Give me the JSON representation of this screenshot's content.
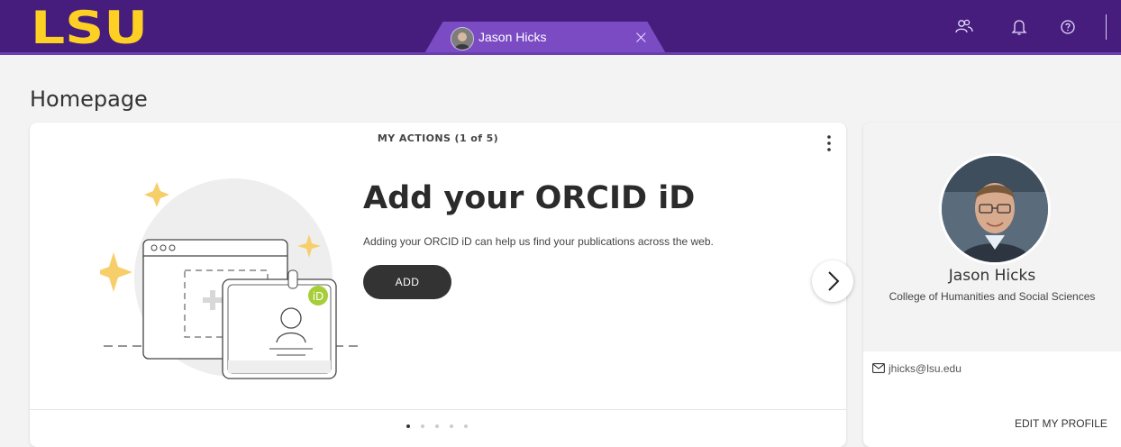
{
  "header": {
    "logo_text": "LSU",
    "user_tab": {
      "name": "Jason Hicks",
      "close_symbol": "×"
    },
    "icons": [
      "people-icon",
      "bell-icon",
      "help-icon"
    ]
  },
  "page": {
    "title": "Homepage"
  },
  "actions": {
    "header_label": "MY ACTIONS (1 of 5)",
    "title": "Add your ORCID iD",
    "description": "Adding your ORCID iD can help us find your publications across the web.",
    "add_label": "ADD",
    "orcid_badge": "iD",
    "pager": {
      "current": 1,
      "total": 5
    }
  },
  "profile": {
    "name": "Jason Hicks",
    "college": "College of Humanities and Social Sciences",
    "email": "jhicks@lsu.edu",
    "edit_label": "EDIT MY PROFILE"
  },
  "colors": {
    "lsu_purple": "#461d7c",
    "lsu_gold": "#fdd023",
    "orcid_green": "#a6ce39",
    "button_dark": "#333333"
  }
}
